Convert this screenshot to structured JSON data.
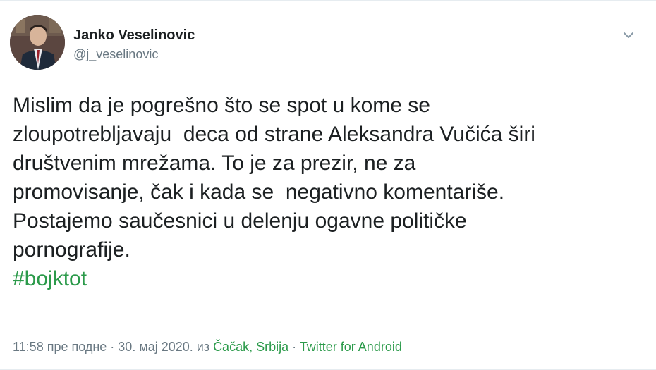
{
  "author": {
    "name": "Janko Veselinovic",
    "handle": "@j_veselinovic",
    "avatar_icon": "profile-photo"
  },
  "header": {
    "menu_icon": "chevron-down-icon"
  },
  "tweet": {
    "lines": [
      "Mislim da je pogrešno što se spot u kome se",
      "zloupotrebljavaju  deca od strane Aleksandra Vučića širi",
      "društvenim mrežama. To je za prezir, ne za",
      "promovisanje, čak i kada se  negativno komentariše.",
      "Postajemo saučesnici u delenju ogavne političke",
      "pornografije."
    ],
    "hashtag": "#bojktot"
  },
  "meta": {
    "time": "11:58 пре подне",
    "sep1": " · ",
    "date": "30. мај 2020.",
    "from_word": " из ",
    "location": "Čačak, Srbija",
    "sep2": " · ",
    "source": "Twitter for Android"
  },
  "colors": {
    "link": "#2b9a4a",
    "secondary_text": "#697882",
    "primary_text": "#1c2022"
  }
}
